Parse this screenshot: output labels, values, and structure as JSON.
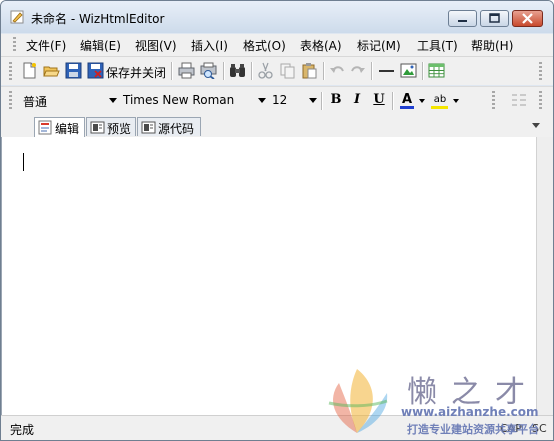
{
  "window": {
    "title": "未命名 - WizHtmlEditor",
    "app_icon": "pencil-icon"
  },
  "menu": [
    {
      "label": "文件(F)"
    },
    {
      "label": "编辑(E)"
    },
    {
      "label": "视图(V)"
    },
    {
      "label": "插入(I)"
    },
    {
      "label": "格式(O)"
    },
    {
      "label": "表格(A)"
    },
    {
      "label": "标记(M)"
    },
    {
      "label": "工具(T)"
    },
    {
      "label": "帮助(H)"
    }
  ],
  "toolbar": {
    "save_close_label": "保存并关闭",
    "icons": [
      "new-document-icon",
      "open-folder-icon",
      "save-icon",
      "save-close-icon",
      "print-icon",
      "print-preview-icon",
      "find-binoculars-icon",
      "cut-icon",
      "copy-icon",
      "paste-icon",
      "undo-icon",
      "redo-icon",
      "horizontal-rule-icon",
      "insert-image-icon",
      "insert-table-icon"
    ]
  },
  "format": {
    "paragraph_style": "普通",
    "font_name": "Times New Roman",
    "font_size": "12",
    "bold": "B",
    "italic": "I",
    "underline": "U",
    "font_color": "A",
    "highlight": "ab",
    "font_color_hex": "#1f3fd0",
    "highlight_hex": "#f5e600"
  },
  "tabs": [
    {
      "label": "编辑",
      "active": true,
      "icon": "edit-doc-icon"
    },
    {
      "label": "预览",
      "active": false,
      "icon": "preview-icon"
    },
    {
      "label": "源代码",
      "active": false,
      "icon": "source-code-icon"
    }
  ],
  "status": {
    "text": "完成",
    "cap": "CAP",
    "sc": "SC"
  },
  "watermark": {
    "title": "懒之才",
    "url": "www.aizhanzhe.com",
    "slogan": "打造专业建站资源共享平台"
  }
}
